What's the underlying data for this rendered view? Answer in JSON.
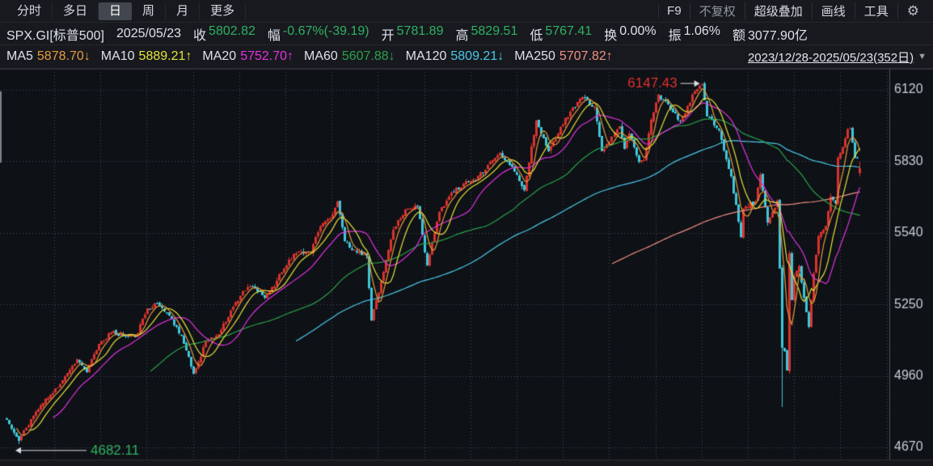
{
  "toolbar": {
    "tabs": [
      "分时",
      "多日",
      "日",
      "周",
      "月",
      "更多"
    ],
    "active_tab": "日",
    "f9": "F9",
    "buttons": [
      "不复权",
      "超级叠加",
      "画线",
      "工具"
    ],
    "gear_icon": "⚙"
  },
  "quote": {
    "symbol": "SPX.GI[标普500]",
    "date": "2025/05/23",
    "close_label": "收",
    "close": "5802.82",
    "change_label": "幅",
    "change": "-0.67%(-39.19)",
    "open_label": "开",
    "open": "5781.89",
    "high_label": "高",
    "high": "5829.51",
    "low_label": "低",
    "low": "5767.41",
    "turnover_label": "换",
    "turnover": "0.00%",
    "amplitude_label": "振",
    "amplitude": "1.06%",
    "amount_label": "额",
    "amount": "3077.90亿"
  },
  "ma_row": {
    "items": [
      {
        "label": "MA5",
        "value": "5878.70↓",
        "color": "#e89a3c"
      },
      {
        "label": "MA10",
        "value": "5889.21↑",
        "color": "#e5e33a"
      },
      {
        "label": "MA20",
        "value": "5752.70↑",
        "color": "#e231e2"
      },
      {
        "label": "MA60",
        "value": "5607.88↓",
        "color": "#2aa14b"
      },
      {
        "label": "MA120",
        "value": "5809.21↓",
        "color": "#4ac9e9"
      },
      {
        "label": "MA250",
        "value": "5707.82↑",
        "color": "#ef8f83"
      }
    ],
    "range": "2023/12/28-2025/05/23(352日)",
    "dropdown_icon": "▼"
  },
  "chart_data": {
    "type": "candlestick",
    "symbol": "SPX.GI",
    "days": 352,
    "ylim": [
      4670,
      6120
    ],
    "y_ticks": [
      6120,
      5830,
      5540,
      5250,
      4960,
      4670
    ],
    "grid": true,
    "anchors": [
      [
        0,
        4783
      ],
      [
        2,
        4746
      ],
      [
        5,
        4697
      ],
      [
        10,
        4784
      ],
      [
        14,
        4840
      ],
      [
        19,
        4891
      ],
      [
        24,
        4959
      ],
      [
        29,
        5027
      ],
      [
        33,
        4976
      ],
      [
        38,
        5089
      ],
      [
        43,
        5137
      ],
      [
        48,
        5124
      ],
      [
        53,
        5117
      ],
      [
        58,
        5234
      ],
      [
        62,
        5254
      ],
      [
        67,
        5204
      ],
      [
        72,
        5123
      ],
      [
        77,
        4967
      ],
      [
        82,
        5100
      ],
      [
        87,
        5128
      ],
      [
        92,
        5223
      ],
      [
        97,
        5303
      ],
      [
        101,
        5322
      ],
      [
        106,
        5278
      ],
      [
        111,
        5347
      ],
      [
        116,
        5432
      ],
      [
        120,
        5465
      ],
      [
        125,
        5460
      ],
      [
        129,
        5567
      ],
      [
        134,
        5615
      ],
      [
        136,
        5667
      ],
      [
        139,
        5505
      ],
      [
        144,
        5459
      ],
      [
        148,
        5446
      ],
      [
        150,
        5186
      ],
      [
        154,
        5344
      ],
      [
        159,
        5554
      ],
      [
        164,
        5635
      ],
      [
        169,
        5648
      ],
      [
        173,
        5408
      ],
      [
        178,
        5626
      ],
      [
        183,
        5703
      ],
      [
        188,
        5738
      ],
      [
        193,
        5751
      ],
      [
        198,
        5815
      ],
      [
        203,
        5865
      ],
      [
        208,
        5808
      ],
      [
        213,
        5713
      ],
      [
        218,
        5996
      ],
      [
        223,
        5871
      ],
      [
        228,
        5969
      ],
      [
        232,
        6032
      ],
      [
        237,
        6090
      ],
      [
        242,
        6051
      ],
      [
        245,
        5872
      ],
      [
        249,
        5931
      ],
      [
        252,
        5971
      ],
      [
        254,
        5882
      ],
      [
        256,
        5942
      ],
      [
        260,
        5827
      ],
      [
        262,
        5836
      ],
      [
        265,
        5997
      ],
      [
        268,
        6101
      ],
      [
        273,
        6041
      ],
      [
        277,
        5994
      ],
      [
        279,
        6026
      ],
      [
        283,
        6115
      ],
      [
        286,
        6144
      ],
      [
        288,
        6013
      ],
      [
        293,
        5955
      ],
      [
        298,
        5770
      ],
      [
        302,
        5522
      ],
      [
        303,
        5639
      ],
      [
        308,
        5668
      ],
      [
        310,
        5777
      ],
      [
        313,
        5581
      ],
      [
        317,
        5671
      ],
      [
        318,
        5396
      ],
      [
        319,
        5074
      ],
      [
        320,
        5062
      ],
      [
        321,
        4983
      ],
      [
        322,
        5457
      ],
      [
        323,
        5268
      ],
      [
        324,
        5363
      ],
      [
        326,
        5406
      ],
      [
        328,
        5276
      ],
      [
        330,
        5158
      ],
      [
        332,
        5376
      ],
      [
        334,
        5525
      ],
      [
        337,
        5569
      ],
      [
        339,
        5687
      ],
      [
        341,
        5660
      ],
      [
        342,
        5844
      ],
      [
        344,
        5887
      ],
      [
        346,
        5958
      ],
      [
        347,
        5964
      ],
      [
        349,
        5845
      ],
      [
        350,
        5842
      ],
      [
        351,
        5802.82
      ]
    ],
    "wick_points": [
      [
        319,
        4835
      ]
    ],
    "last_bar": {
      "open": 5781.89,
      "high": 5829.51,
      "low": 5767.41,
      "close": 5802.82
    },
    "annotations": {
      "period_high": {
        "day": 286,
        "price": 6147.43,
        "label": "6147.43"
      },
      "period_low": {
        "day": 5,
        "price": 4682.11,
        "label": "4682.11"
      }
    },
    "ma": [
      {
        "period": 5,
        "color": "#e89a3c"
      },
      {
        "period": 10,
        "color": "#e5e33a"
      },
      {
        "period": 20,
        "color": "#e231e2"
      },
      {
        "period": 60,
        "color": "#2aa14b"
      },
      {
        "period": 120,
        "color": "#4ac9e9"
      },
      {
        "period": 250,
        "color": "#ef8f83"
      }
    ],
    "colors": {
      "up": "#d9322e",
      "down": "#3fc6da",
      "grid": "#474b53",
      "axis_line": "#51555c",
      "axis_label": "#c9ced6",
      "high_label": "#e0322e",
      "low_label": "#2fb162",
      "arrow": "#d9dde3",
      "background": "#0e1116"
    },
    "legend_position": "top-left-header"
  }
}
